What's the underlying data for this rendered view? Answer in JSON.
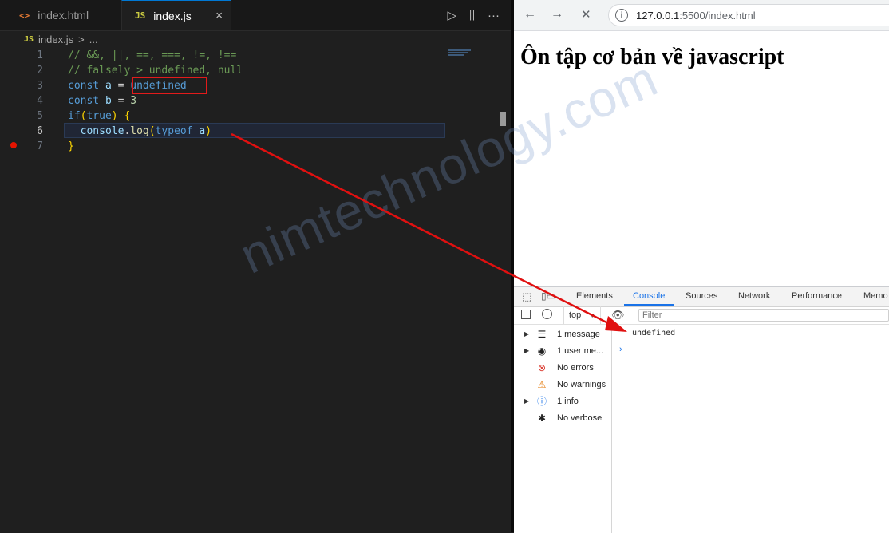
{
  "editor": {
    "tabs": [
      {
        "icon": "<>",
        "label": "index.html",
        "close": ""
      },
      {
        "icon": "JS",
        "label": "index.js",
        "close": "×"
      }
    ],
    "actions": {
      "run": "▷",
      "split": "⫼",
      "more": "···"
    },
    "breadcrumb": {
      "icon": "JS",
      "file": "index.js",
      "sep": ">",
      "rest": "..."
    },
    "lines": [
      {
        "n": "1",
        "parts": [
          [
            "cm",
            "// &&, ||, ==, ===, !=, !=="
          ]
        ]
      },
      {
        "n": "2",
        "parts": [
          [
            "cm",
            "// falsely > undefined, null"
          ]
        ]
      },
      {
        "n": "3",
        "parts": [
          [
            "kw",
            "const "
          ],
          [
            "var",
            "a"
          ],
          [
            "p",
            " = "
          ],
          [
            "kw",
            "undefined"
          ]
        ]
      },
      {
        "n": "4",
        "parts": [
          [
            "kw",
            "const "
          ],
          [
            "var",
            "b"
          ],
          [
            "p",
            " = "
          ],
          [
            "num",
            "3"
          ]
        ]
      },
      {
        "n": "5",
        "parts": [
          [
            "kw",
            "if"
          ],
          [
            "br",
            "("
          ],
          [
            "kw",
            "true"
          ],
          [
            "br",
            ")"
          ],
          [
            "p",
            " "
          ],
          [
            "br",
            "{"
          ]
        ]
      },
      {
        "n": "6",
        "parts": [
          [
            "p",
            "  "
          ],
          [
            "var",
            "console"
          ],
          [
            "p",
            "."
          ],
          [
            "fn",
            "log"
          ],
          [
            "br",
            "("
          ],
          [
            "ty",
            "typeof "
          ],
          [
            "var",
            "a"
          ],
          [
            "br",
            ")"
          ]
        ]
      },
      {
        "n": "7",
        "parts": [
          [
            "br",
            "}"
          ]
        ]
      }
    ]
  },
  "browser": {
    "nav": {
      "back": "←",
      "forward": "→",
      "stop": "✕"
    },
    "url_host": "127.0.0.1",
    "url_rest": ":5500/index.html",
    "page_title": "Ôn tập cơ bản về javascript",
    "devtools": {
      "tabs": [
        "Elements",
        "Console",
        "Sources",
        "Network",
        "Performance",
        "Memo"
      ],
      "context": "top",
      "filter_placeholder": "Filter",
      "sidebar": [
        {
          "arrow": "▶",
          "icon": "☰",
          "label": "1 message",
          "kind": ""
        },
        {
          "arrow": "▶",
          "icon": "◉",
          "label": "1 user me...",
          "kind": ""
        },
        {
          "arrow": "",
          "icon": "⊗",
          "label": "No errors",
          "kind": "err"
        },
        {
          "arrow": "",
          "icon": "⚠",
          "label": "No warnings",
          "kind": "warn"
        },
        {
          "arrow": "▶",
          "icon": "ⓘ",
          "label": "1 info",
          "kind": "info"
        },
        {
          "arrow": "",
          "icon": "✱",
          "label": "No verbose",
          "kind": ""
        }
      ],
      "log": "undefined",
      "prompt": "›"
    }
  },
  "watermark": "nimtechnology.com",
  "colors": {
    "highlight_box": "#e21b1b",
    "arrow": "#e01010",
    "accent": "#1a73e8"
  }
}
